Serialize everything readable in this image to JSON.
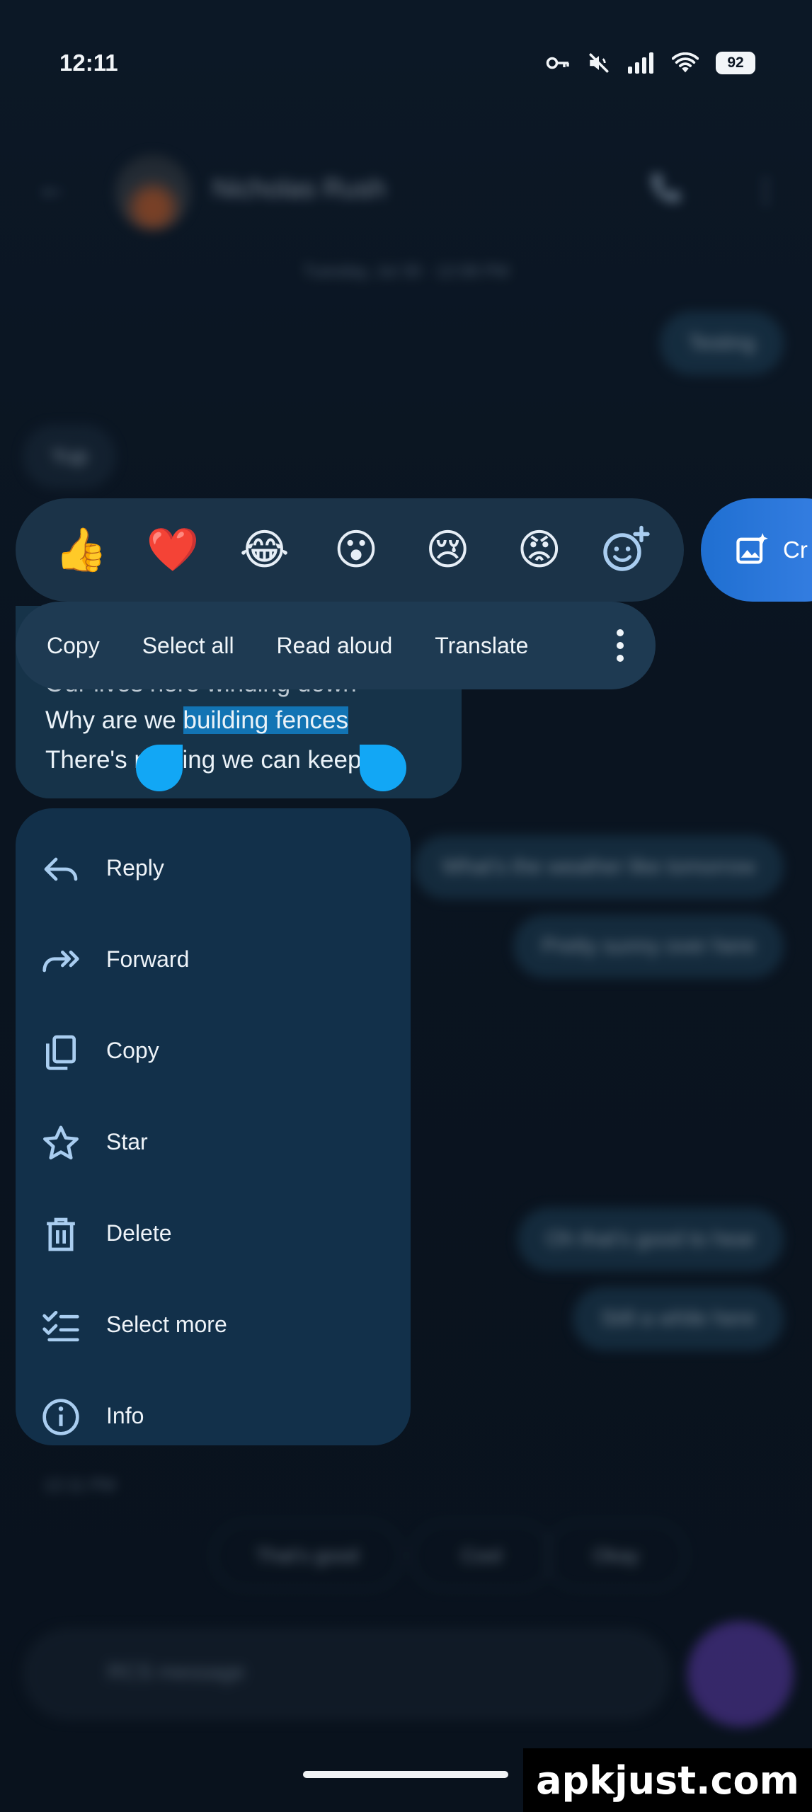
{
  "status_bar": {
    "time": "12:11",
    "battery": "92",
    "icons": [
      "key-icon",
      "mute-icon",
      "signal-icon",
      "wifi-icon",
      "battery-icon"
    ]
  },
  "conversation_bg": {
    "contact_name": "Nicholas Rush",
    "date": "Tuesday, Jul 30 · 12:08 PM",
    "bubbles": [
      {
        "text": "Testing",
        "side": "out"
      },
      {
        "text": "Yup",
        "side": "in"
      },
      {
        "text": "What's the weather like tomorrow",
        "side": "out"
      },
      {
        "text": "Pretty sunny over here",
        "side": "out"
      },
      {
        "text": "Oh that's good to hear",
        "side": "out"
      },
      {
        "text": "Still a while here",
        "side": "out"
      }
    ],
    "timestamp": "12:11 PM",
    "suggestions": [
      "That's good",
      "Cool",
      "Okay"
    ],
    "compose_placeholder": "RCS message"
  },
  "reactions": {
    "emojis": [
      "👍",
      "❤️",
      "😂",
      "😮",
      "😢",
      "😡"
    ],
    "create_label": "Cr"
  },
  "message": {
    "line1": "Our lives here winding down",
    "line2_pre": "Why are we ",
    "line2_sel": "building fences",
    "line3": "There's nothing we can keep out"
  },
  "text_toolbar": {
    "copy": "Copy",
    "select_all": "Select all",
    "read_aloud": "Read aloud",
    "translate": "Translate"
  },
  "context_menu": {
    "items": [
      {
        "label": "Reply",
        "icon": "reply-icon"
      },
      {
        "label": "Forward",
        "icon": "forward-icon"
      },
      {
        "label": "Copy",
        "icon": "copy-icon"
      },
      {
        "label": "Star",
        "icon": "star-icon"
      },
      {
        "label": "Delete",
        "icon": "trash-icon"
      },
      {
        "label": "Select more",
        "icon": "checklist-icon"
      },
      {
        "label": "Info",
        "icon": "info-icon"
      }
    ]
  },
  "watermark": "apkjust.com",
  "colors": {
    "background": "#0b1522",
    "menu": "#12304a",
    "toolbar": "#1e3a52",
    "selection": "#1274b4",
    "handle": "#12a7f5",
    "accent": "#1f6fd1"
  }
}
